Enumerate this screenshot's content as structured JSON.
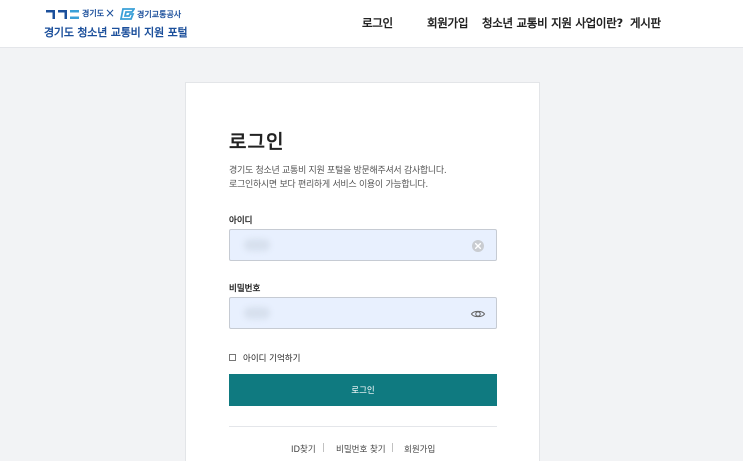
{
  "header": {
    "logo": {
      "gg_text": "경기도",
      "times": "×",
      "gti_text": "경기교통공사",
      "title": "경기도 청소년 교통비 지원 포털"
    },
    "nav": [
      {
        "label": "로그인"
      },
      {
        "label": "회원가입"
      },
      {
        "label": "청소년 교통비 지원 사업이란?"
      },
      {
        "label": "게시판"
      }
    ]
  },
  "login": {
    "title": "로그인",
    "description_line1": "경기도 청소년 교통비 지원 포털을 방문해주셔서 감사합니다.",
    "description_line2": "로그인하시면 보다 편리하게 서비스 이용이 가능합니다.",
    "id_label": "아이디",
    "id_value": "",
    "password_label": "비밀번호",
    "password_value": "",
    "remember_label": "아이디 기억하기",
    "submit_label": "로그인",
    "links": [
      {
        "label": "ID찾기"
      },
      {
        "label": "비밀번호 찾기"
      },
      {
        "label": "회원가입"
      }
    ],
    "separator": "|"
  },
  "colors": {
    "brand": "#1b4f9b",
    "button": "#0f7a80",
    "input_bg": "#e8f0fe",
    "page_bg": "#f2f3f5"
  }
}
